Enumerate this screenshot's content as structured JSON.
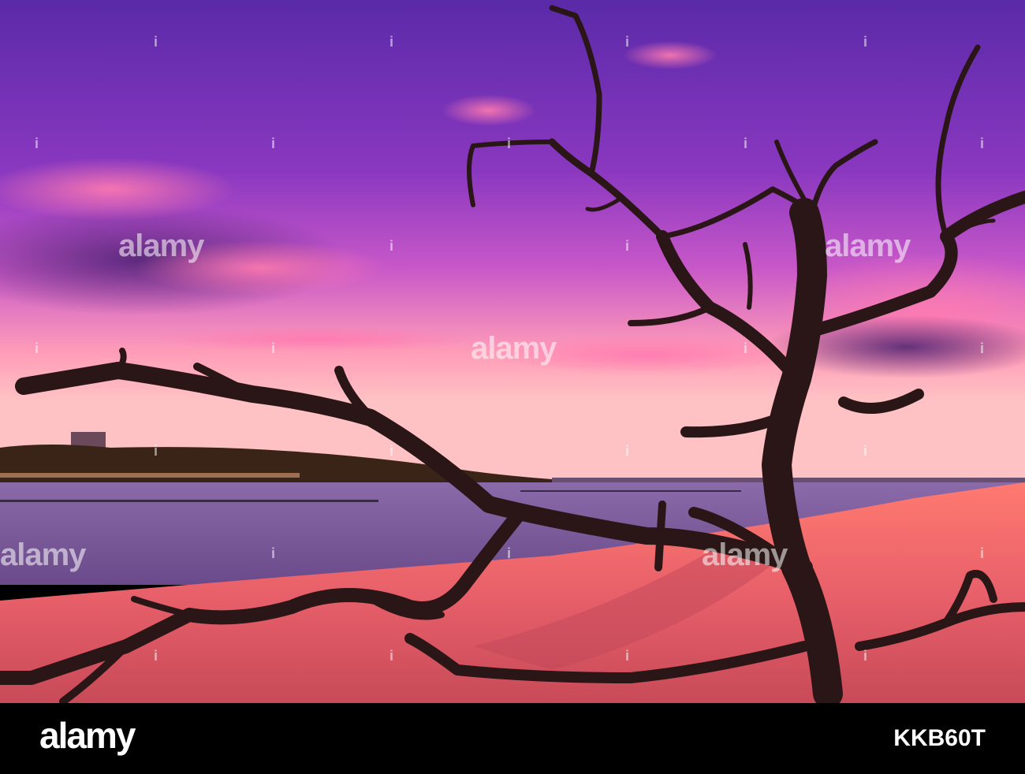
{
  "watermark": {
    "text": "alamy"
  },
  "footer": {
    "brand": "alamy",
    "image_id": "KKB60T"
  },
  "colors": {
    "sky_top": "#5a2aa8",
    "sky_mid": "#b04cc8",
    "sky_horizon": "#ff9ab0",
    "water": "#7a5a9a",
    "sand": "#e8606a",
    "tree": "#2a1616"
  }
}
